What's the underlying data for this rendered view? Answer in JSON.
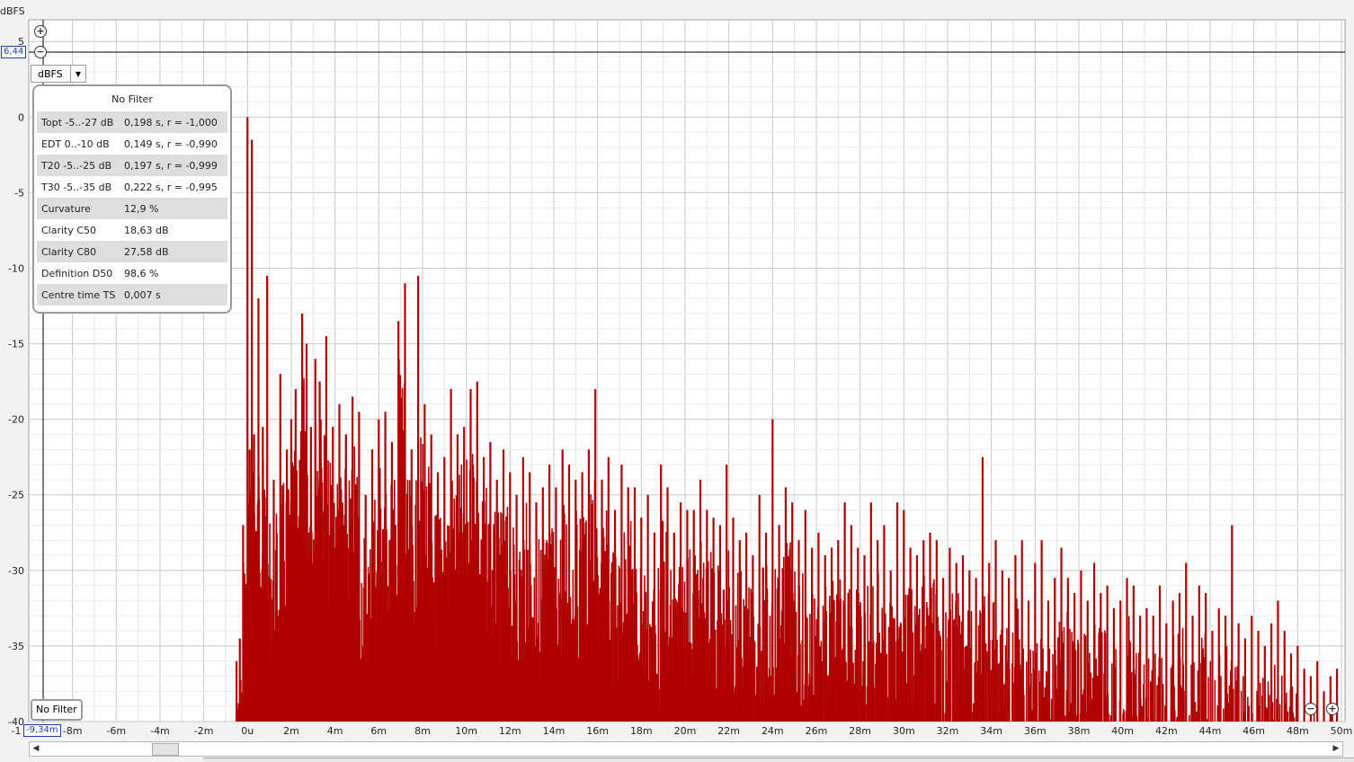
{
  "chart_data": {
    "type": "bar",
    "y_unit": "dBFS",
    "ylim": [
      -40,
      6.44
    ],
    "xlim": [
      "-9,34m",
      "50m"
    ],
    "y_ticks": [
      "5",
      "0",
      "-5",
      "-10",
      "-15",
      "-20",
      "-25",
      "-30",
      "-35",
      "-40"
    ],
    "x_ticks": [
      "-1",
      "-8m",
      "-6m",
      "-4m",
      "-2m",
      "0u",
      "2m",
      "4m",
      "6m",
      "8m",
      "10m",
      "12m",
      "14m",
      "16m",
      "18m",
      "20m",
      "22m",
      "24m",
      "26m",
      "28m",
      "30m",
      "32m",
      "34m",
      "36m",
      "38m",
      "40m",
      "42m",
      "44m",
      "46m",
      "48m",
      "50m"
    ],
    "grid": true,
    "series_color": "#b00000",
    "x_ms": [
      -0.5,
      -0.35,
      -0.2,
      0,
      0.1,
      0.2,
      0.3,
      0.5,
      0.7,
      0.9,
      1.2,
      1.5,
      1.8,
      2,
      2.2,
      2.5,
      2.7,
      2.9,
      3.1,
      3.3,
      3.6,
      3.9,
      4.2,
      4.5,
      4.8,
      5.1,
      5.4,
      5.7,
      6.0,
      6.3,
      6.6,
      6.9,
      7.2,
      7.5,
      7.8,
      8.1,
      8.4,
      8.7,
      9.0,
      9.3,
      9.6,
      9.9,
      10.2,
      10.5,
      10.8,
      11.1,
      11.4,
      11.7,
      12.0,
      12.3,
      12.6,
      12.9,
      13.2,
      13.5,
      13.8,
      14.1,
      14.4,
      14.7,
      15.0,
      15.3,
      15.6,
      15.9,
      16.2,
      16.5,
      16.8,
      17.1,
      17.4,
      17.7,
      18.0,
      18.3,
      18.6,
      18.9,
      19.2,
      19.5,
      19.8,
      20.1,
      20.4,
      20.7,
      21.0,
      21.3,
      21.6,
      21.9,
      22.2,
      22.5,
      22.8,
      23.1,
      23.4,
      23.7,
      24.0,
      24.3,
      24.6,
      24.9,
      25.2,
      25.5,
      25.8,
      26.1,
      26.4,
      26.7,
      27.0,
      27.3,
      27.6,
      27.9,
      28.2,
      28.5,
      28.8,
      29.1,
      29.4,
      29.7,
      30.0,
      30.3,
      30.6,
      30.9,
      31.2,
      31.5,
      31.8,
      32.1,
      32.4,
      32.7,
      33.0,
      33.3,
      33.6,
      33.9,
      34.2,
      34.5,
      34.8,
      35.1,
      35.4,
      35.7,
      36.0,
      36.3,
      36.6,
      36.9,
      37.2,
      37.5,
      37.8,
      38.1,
      38.4,
      38.7,
      39.0,
      39.3,
      39.6,
      39.9,
      40.2,
      40.5,
      40.8,
      41.1,
      41.4,
      41.7,
      42.0,
      42.3,
      42.6,
      42.9,
      43.2,
      43.5,
      43.8,
      44.1,
      44.4,
      44.7,
      45.0,
      45.3,
      45.6,
      45.9,
      46.2,
      46.5,
      46.8,
      47.1,
      47.4,
      47.7,
      48.0,
      48.3,
      48.6,
      48.9,
      49.2,
      49.5,
      49.8
    ],
    "y_dbfs": [
      -36,
      -34.5,
      -27,
      0,
      -22,
      -1.5,
      -21,
      -12,
      -20.5,
      -10.5,
      -24,
      -17,
      -22,
      -20,
      -18,
      -13,
      -15,
      -20.5,
      -16,
      -17.5,
      -14.5,
      -20.5,
      -19,
      -21,
      -18.5,
      -19.5,
      -25,
      -22,
      -20,
      -19.5,
      -21.5,
      -13.5,
      -11,
      -22,
      -10.5,
      -19,
      -21,
      -23.5,
      -22.5,
      -18,
      -21,
      -20.5,
      -18,
      -17.5,
      -22.5,
      -21.5,
      -24,
      -22,
      -23.5,
      -25,
      -22.5,
      -23.5,
      -25.5,
      -24.5,
      -23,
      -24.5,
      -22,
      -23,
      -24,
      -23.5,
      -22,
      -18,
      -24,
      -22.5,
      -26,
      -23,
      -24.5,
      -24.5,
      -26.5,
      -25,
      -27.5,
      -23,
      -24.5,
      -27.5,
      -25.5,
      -26,
      -26,
      -24,
      -26,
      -26.5,
      -27,
      -23,
      -26.5,
      -28,
      -27.5,
      -29,
      -25,
      -27.5,
      -20,
      -27,
      -24.5,
      -25.5,
      -28,
      -26,
      -28.5,
      -27.5,
      -29,
      -28.5,
      -28,
      -25.5,
      -27,
      -28.5,
      -29,
      -25.5,
      -28,
      -27,
      -30,
      -25.5,
      -26,
      -28.5,
      -29,
      -28,
      -27.5,
      -28,
      -30.5,
      -28.5,
      -29.5,
      -29,
      -30,
      -30.5,
      -22.5,
      -29.5,
      -28,
      -30,
      -30.5,
      -29,
      -28,
      -32,
      -29.5,
      -28,
      -32,
      -30.5,
      -28.5,
      -30.5,
      -31.5,
      -30,
      -32,
      -29.5,
      -31.5,
      -31,
      -32.5,
      -32,
      -30.5,
      -31,
      -33,
      -32.5,
      -33,
      -31,
      -33.5,
      -32,
      -31.5,
      -29.5,
      -33,
      -31,
      -31.5,
      -34,
      -32.5,
      -33,
      -27,
      -33.5,
      -34.5,
      -33,
      -34,
      -35,
      -33.5,
      -32,
      -34,
      -35.5,
      -35,
      -36.5,
      -37,
      -36,
      -38,
      -37,
      -36.5,
      -38.5,
      -38
    ]
  },
  "labels": {
    "y_axis_unit": "dBFS",
    "cursor_y": "6,44",
    "cursor_x": "-9,34m",
    "unit_select": "dBFS",
    "filter_button": "No Filter"
  },
  "stats_panel": {
    "title": "No Filter",
    "rows": [
      {
        "label": "Topt -5..-27 dB",
        "value": "0,198 s,  r = -1,000"
      },
      {
        "label": "EDT  0..-10 dB",
        "value": "0,149 s,  r = -0,990"
      },
      {
        "label": "T20 -5..-25 dB",
        "value": "0,197 s,  r = -0,999"
      },
      {
        "label": "T30 -5..-35 dB",
        "value": "0,222 s,  r = -0,995"
      },
      {
        "label": "Curvature",
        "value": "12,9 %"
      },
      {
        "label": "Clarity C50",
        "value": "18,63 dB"
      },
      {
        "label": "Clarity C80",
        "value": "27,58 dB"
      },
      {
        "label": "Definition D50",
        "value": "98,6 %"
      },
      {
        "label": "Centre time TS",
        "value": "0,007 s"
      }
    ]
  },
  "icons": [
    "zoom-in-icon",
    "zoom-out-icon",
    "scroll-left-icon",
    "scroll-right-icon",
    "dropdown-arrow-icon"
  ]
}
